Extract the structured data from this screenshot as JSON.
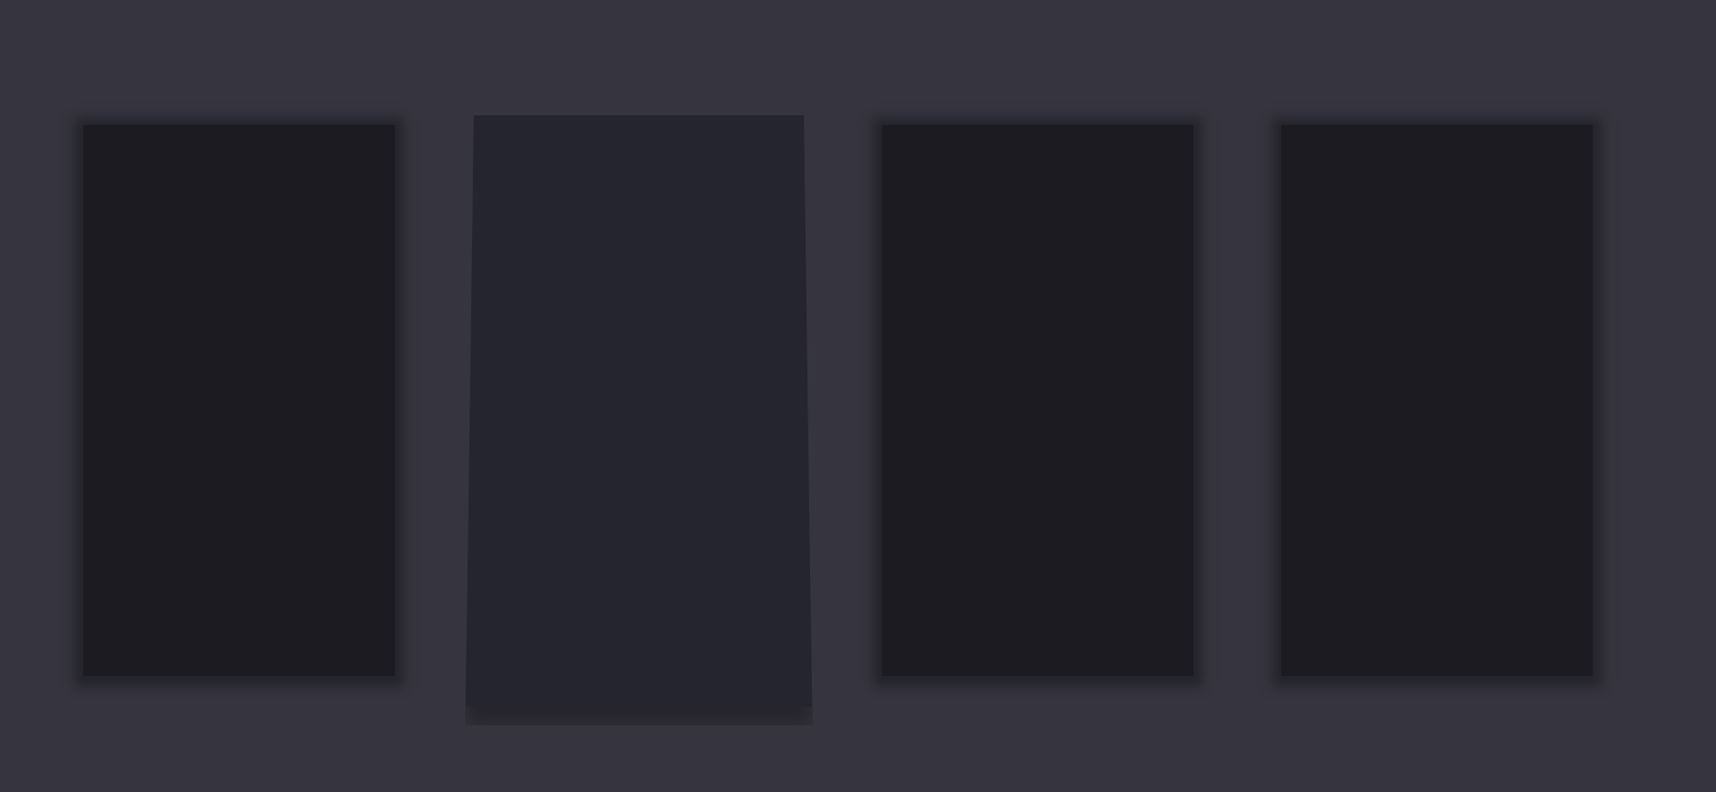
{
  "colors": {
    "background": "#36353f",
    "card": "#1c1b21",
    "card_highlighted": "#25252f"
  },
  "cards": [
    {
      "state": "normal"
    },
    {
      "state": "highlighted"
    },
    {
      "state": "normal"
    },
    {
      "state": "normal"
    }
  ]
}
